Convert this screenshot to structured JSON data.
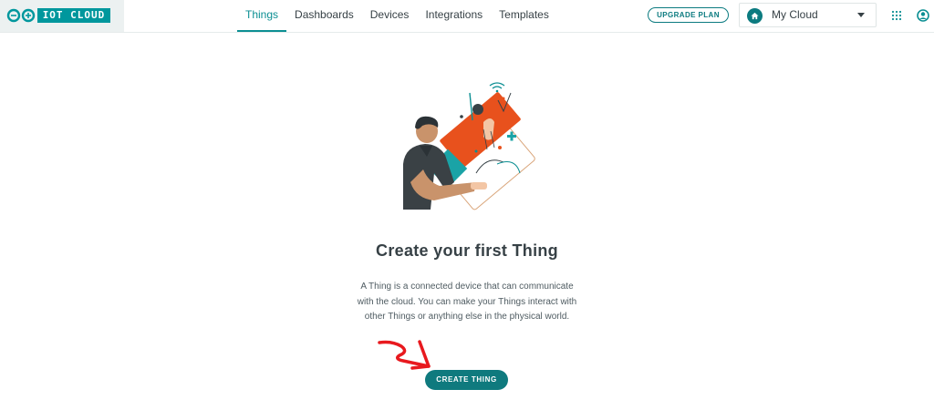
{
  "brand": {
    "name": "IOT CLOUD",
    "accent": "#00979d"
  },
  "nav": {
    "tabs": [
      {
        "label": "Things",
        "active": true
      },
      {
        "label": "Dashboards",
        "active": false
      },
      {
        "label": "Devices",
        "active": false
      },
      {
        "label": "Integrations",
        "active": false
      },
      {
        "label": "Templates",
        "active": false
      }
    ]
  },
  "header": {
    "upgrade_label": "UPGRADE PLAN",
    "cloud_selector": {
      "value": "My Cloud",
      "icon": "home-icon"
    },
    "apps_icon": "grid-icon",
    "account_icon": "account-icon"
  },
  "empty_state": {
    "illustration": "person-holding-device-illustration",
    "title": "Create your first Thing",
    "description": "A Thing is a connected device that can communicate with the cloud. You can make your Things interact with other Things or anything else in the physical world.",
    "button_label": "CREATE THING"
  },
  "colors": {
    "primary": "#0f7a7e",
    "annotation_arrow": "#e8191e",
    "illustration_orange": "#e8511d"
  }
}
